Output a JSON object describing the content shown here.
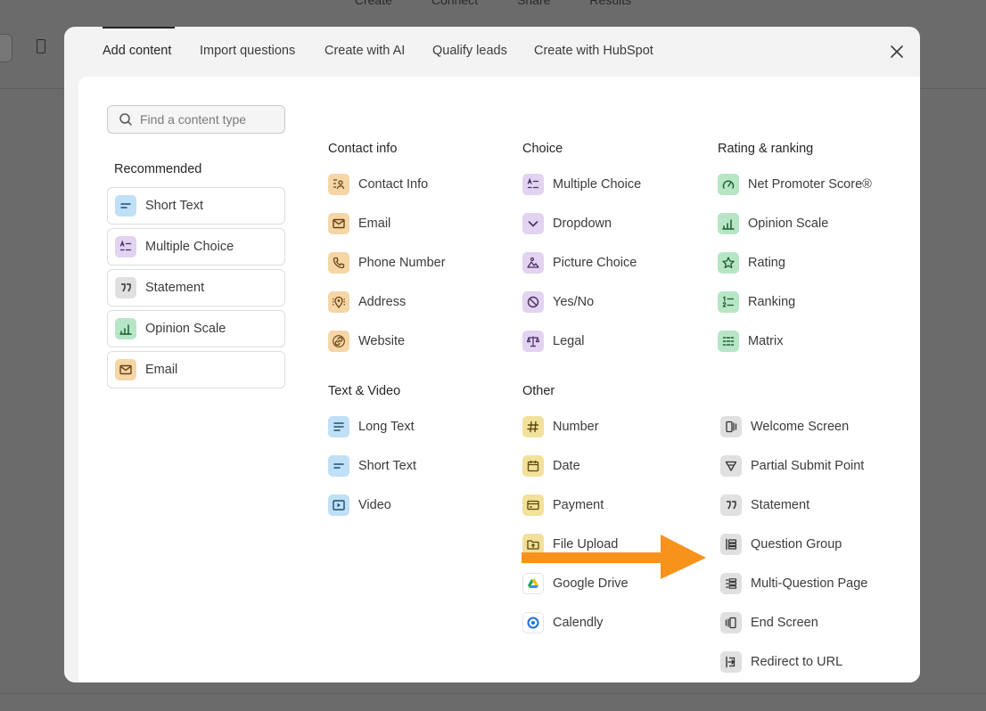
{
  "background": {
    "nav": [
      "Create",
      "Connect",
      "Share",
      "Results"
    ]
  },
  "tabs": [
    {
      "label": "Add content",
      "active": true
    },
    {
      "label": "Import questions"
    },
    {
      "label": "Create with AI"
    },
    {
      "label": "Qualify leads"
    },
    {
      "label": "Create with HubSpot"
    }
  ],
  "search": {
    "placeholder": "Find a content type",
    "value": ""
  },
  "recommended": {
    "heading": "Recommended",
    "items": [
      {
        "label": "Short Text",
        "icon": "short-text-icon",
        "color": "#bfe0f7"
      },
      {
        "label": "Multiple Choice",
        "icon": "multiple-choice-icon",
        "color": "#e2d3f1"
      },
      {
        "label": "Statement",
        "icon": "quote-icon",
        "color": "#e0e0e0"
      },
      {
        "label": "Opinion Scale",
        "icon": "bar-chart-icon",
        "color": "#b6e6c6"
      },
      {
        "label": "Email",
        "icon": "envelope-icon",
        "color": "#f6d6a6"
      }
    ]
  },
  "contact_info": {
    "heading": "Contact info",
    "items": [
      {
        "label": "Contact Info",
        "icon": "contact-card-icon"
      },
      {
        "label": "Email",
        "icon": "envelope-icon"
      },
      {
        "label": "Phone Number",
        "icon": "phone-icon"
      },
      {
        "label": "Address",
        "icon": "map-pin-icon"
      },
      {
        "label": "Website",
        "icon": "link-icon"
      }
    ]
  },
  "text_video": {
    "heading": "Text & Video",
    "items": [
      {
        "label": "Long Text",
        "icon": "long-text-icon"
      },
      {
        "label": "Short Text",
        "icon": "short-text-icon"
      },
      {
        "label": "Video",
        "icon": "video-icon"
      }
    ]
  },
  "choice": {
    "heading": "Choice",
    "items": [
      {
        "label": "Multiple Choice",
        "icon": "multiple-choice-icon"
      },
      {
        "label": "Dropdown",
        "icon": "chevron-down-icon"
      },
      {
        "label": "Picture Choice",
        "icon": "picture-icon"
      },
      {
        "label": "Yes/No",
        "icon": "yes-no-icon"
      },
      {
        "label": "Legal",
        "icon": "scales-icon"
      }
    ]
  },
  "other": {
    "heading": "Other",
    "items": [
      {
        "label": "Number",
        "icon": "hash-icon"
      },
      {
        "label": "Date",
        "icon": "calendar-icon"
      },
      {
        "label": "Payment",
        "icon": "credit-card-icon"
      },
      {
        "label": "File Upload",
        "icon": "folder-upload-icon"
      },
      {
        "label": "Google Drive",
        "icon": "google-drive-icon"
      },
      {
        "label": "Calendly",
        "icon": "calendly-icon"
      }
    ]
  },
  "rating_ranking": {
    "heading": "Rating & ranking",
    "items": [
      {
        "label": "Net Promoter Score®",
        "icon": "gauge-icon"
      },
      {
        "label": "Opinion Scale",
        "icon": "bar-chart-icon"
      },
      {
        "label": "Rating",
        "icon": "star-icon"
      },
      {
        "label": "Ranking",
        "icon": "ranking-icon"
      },
      {
        "label": "Matrix",
        "icon": "matrix-icon"
      }
    ]
  },
  "screens": {
    "items": [
      {
        "label": "Welcome Screen",
        "icon": "welcome-screen-icon"
      },
      {
        "label": "Partial Submit Point",
        "icon": "partial-submit-icon"
      },
      {
        "label": "Statement",
        "icon": "quote-icon"
      },
      {
        "label": "Question Group",
        "icon": "question-group-icon"
      },
      {
        "label": "Multi-Question Page",
        "icon": "multi-question-icon"
      },
      {
        "label": "End Screen",
        "icon": "end-screen-icon"
      },
      {
        "label": "Redirect to URL",
        "icon": "redirect-icon"
      }
    ]
  },
  "annotation": {
    "color": "#f7931a",
    "icon": "arrow-right-icon"
  }
}
